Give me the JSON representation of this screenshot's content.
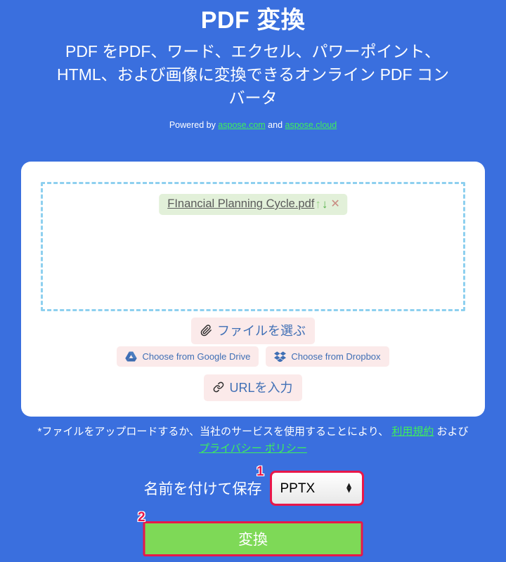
{
  "header": {
    "title": "PDF 変換",
    "subtitle": "PDF をPDF、ワード、エクセル、パワーポイント、HTML、および画像に変換できるオンライン PDF コンバータ",
    "powered_prefix": "Powered by ",
    "powered_link1": "aspose.com",
    "powered_and": " and ",
    "powered_link2": "aspose.cloud"
  },
  "dropzone": {
    "file": {
      "name": "FInancial Planning Cycle.pdf",
      "move_up_icon": "arrow-up-icon",
      "move_down_icon": "arrow-down-icon",
      "remove_icon": "close-icon",
      "up_glyph": "↑",
      "down_glyph": "↓",
      "remove_glyph": "✕"
    }
  },
  "sources": {
    "choose_file": "ファイルを選ぶ",
    "google_drive": "Choose from Google Drive",
    "dropbox": "Choose from Dropbox",
    "enter_url": "URLを入力"
  },
  "terms": {
    "line1_prefix": "*ファイルをアップロードするか、当社のサービスを使用することにより、 ",
    "terms_link": "利用規約",
    "line1_mid": " および",
    "privacy_link": "プライバシー ポリシー"
  },
  "form": {
    "save_as_label": "名前を付けて保存",
    "format_value": "PPTX",
    "format_options": [
      "PPTX"
    ],
    "convert_label": "変換"
  },
  "annotations": {
    "badge_1": "1",
    "badge_2": "2"
  },
  "colors": {
    "background": "#3a6fde",
    "card": "#ffffff",
    "dropzone_border": "#8ed0ef",
    "file_chip_bg": "#e2f0d9",
    "source_btn_bg": "#fbeaea",
    "source_btn_text": "#3f6fb5",
    "link_green": "#3ef05a",
    "convert_green": "#7ed957",
    "highlight_red": "#e8174a"
  }
}
